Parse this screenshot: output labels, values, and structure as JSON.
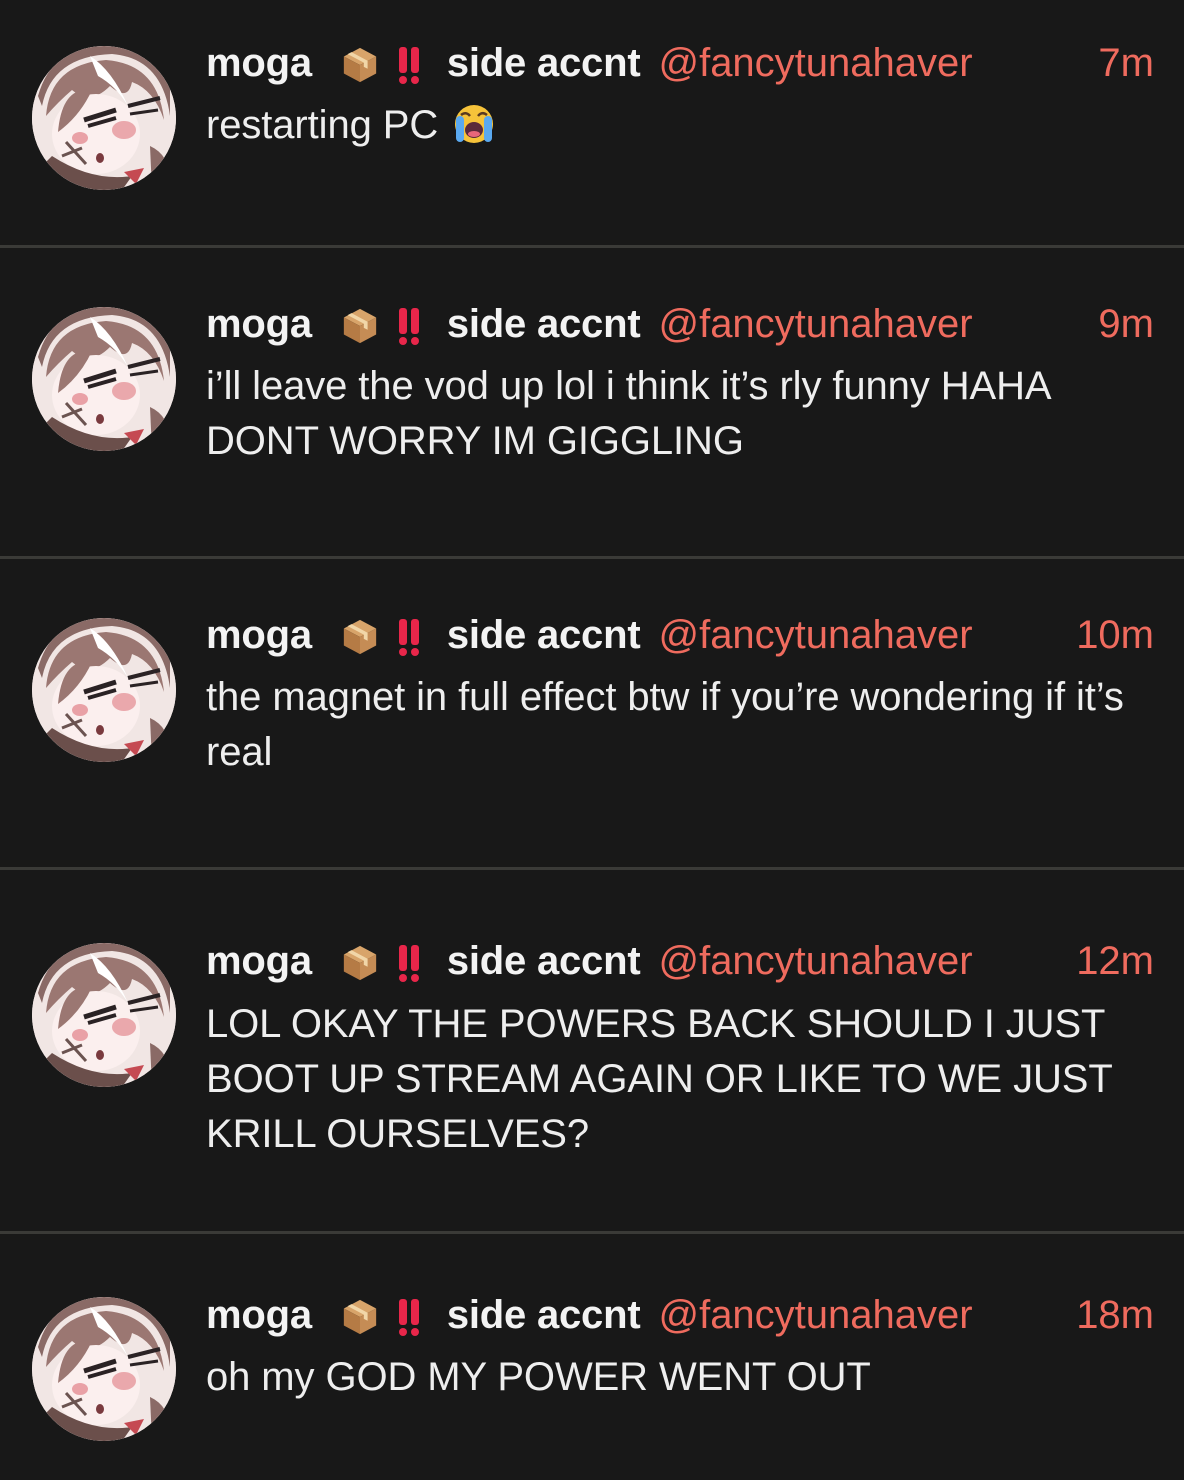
{
  "posts": [
    {
      "display_name_main": "moga",
      "display_name_suffix": "side accnt",
      "handle": "@fancytunahaver",
      "time": "7m",
      "text": "restarting PC",
      "emoji": "loudly-crying-face-icon"
    },
    {
      "display_name_main": "moga",
      "display_name_suffix": "side accnt",
      "handle": "@fancytunahaver",
      "time": "9m",
      "text": "i’ll leave the vod up lol i think it’s rly funny HAHA DONT WORRY IM GIGGLING"
    },
    {
      "display_name_main": "moga",
      "display_name_suffix": "side accnt",
      "handle": "@fancytunahaver",
      "time": "10m",
      "text": "the magnet in full effect btw if you’re wondering if it’s real"
    },
    {
      "display_name_main": "moga",
      "display_name_suffix": "side accnt",
      "handle": "@fancytunahaver",
      "time": "12m",
      "text": "LOL OKAY THE POWERS BACK SHOULD I JUST BOOT UP STREAM AGAIN OR LIKE TO WE JUST KRILL OURSELVES?"
    },
    {
      "display_name_main": "moga",
      "display_name_suffix": "side accnt",
      "handle": "@fancytunahaver",
      "time": "18m",
      "text": "oh my GOD MY POWER WENT OUT"
    }
  ],
  "colors": {
    "background": "#181818",
    "handle": "#ef6b5e",
    "divider": "#3a3a37"
  },
  "icons": [
    "package-icon",
    "double-exclamation-icon",
    "loudly-crying-face-icon",
    "avatar"
  ]
}
